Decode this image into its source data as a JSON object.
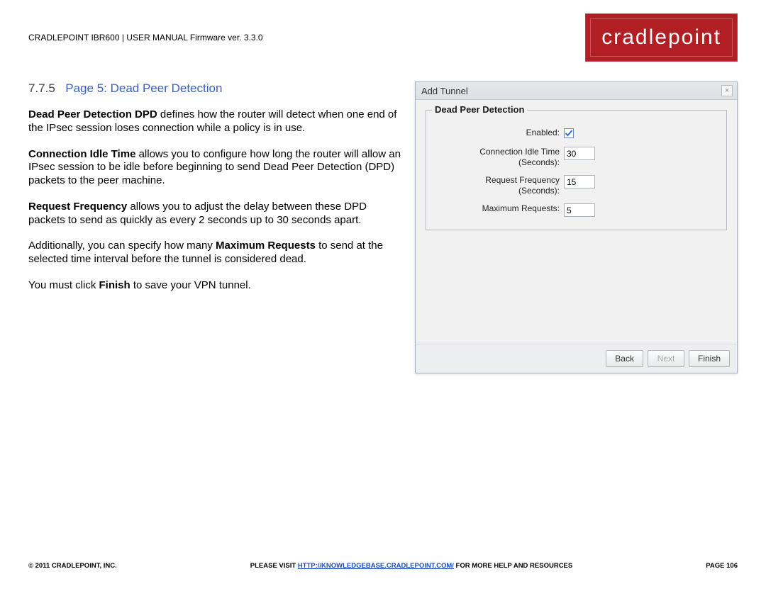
{
  "header": {
    "doc_title": "CRADLEPOINT IBR600 | USER MANUAL Firmware ver. 3.3.0",
    "logo": "cradlepoint"
  },
  "section": {
    "number": "7.7.5",
    "title": "Page 5: Dead Peer Detection"
  },
  "paragraphs": {
    "p1_bold": "Dead Peer Detection DPD",
    "p1_rest": " defines how the router will detect when one end of the IPsec session loses connection while a policy is in use.",
    "p2_bold": "Connection Idle Time",
    "p2_rest": " allows you to configure how long the router will allow an IPsec session to be idle before beginning to send Dead Peer Detection (DPD) packets to the peer machine.",
    "p3_bold": "Request Frequency",
    "p3_rest": " allows you to adjust the delay between these DPD packets to send as quickly as every 2 seconds up to 30 seconds apart.",
    "p4_pre": "Additionally, you can specify how many ",
    "p4_bold": "Maximum Requests",
    "p4_post": " to send at the selected time interval before the tunnel is considered dead.",
    "p5_pre": "You must click ",
    "p5_bold": "Finish",
    "p5_post": " to save your VPN tunnel."
  },
  "dialog": {
    "title": "Add Tunnel",
    "close": "×",
    "fieldset_title": "Dead Peer Detection",
    "rows": {
      "enabled_label": "Enabled:",
      "idle_label_a": "Connection Idle Time",
      "idle_label_b": "(Seconds):",
      "idle_value": "30",
      "freq_label_a": "Request Frequency",
      "freq_label_b": "(Seconds):",
      "freq_value": "15",
      "max_label": "Maximum Requests:",
      "max_value": "5"
    },
    "buttons": {
      "back": "Back",
      "next": "Next",
      "finish": "Finish"
    }
  },
  "footer": {
    "left": "© 2011 CRADLEPOINT, INC.",
    "center_pre": "PLEASE VISIT ",
    "center_link": "HTTP://KNOWLEDGEBASE.CRADLEPOINT.COM/",
    "center_post": " FOR MORE HELP AND RESOURCES",
    "right": "PAGE 106"
  }
}
